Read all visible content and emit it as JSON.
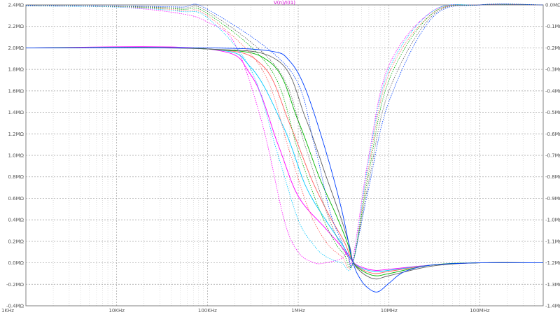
{
  "chart_data": {
    "type": "line",
    "title": "V(n)/I(I1)",
    "x_scale": "log",
    "xlim": [
      1000,
      500000000
    ],
    "x_ticks": [
      {
        "value": 1000,
        "label": "1KHz"
      },
      {
        "value": 10000,
        "label": "10KHz"
      },
      {
        "value": 100000,
        "label": "100KHz"
      },
      {
        "value": 1000000,
        "label": "1MHz"
      },
      {
        "value": 10000000,
        "label": "10MHz"
      },
      {
        "value": 100000000,
        "label": "100MHz"
      }
    ],
    "left_axis": {
      "unit": "MΩ",
      "ylim": [
        -0.4,
        2.4
      ],
      "ticks": [
        {
          "value": 2.4,
          "label": "2.4MΩ"
        },
        {
          "value": 2.2,
          "label": "2.2MΩ"
        },
        {
          "value": 2.0,
          "label": "2.0MΩ"
        },
        {
          "value": 1.8,
          "label": "1.8MΩ"
        },
        {
          "value": 1.6,
          "label": "1.6MΩ"
        },
        {
          "value": 1.4,
          "label": "1.4MΩ"
        },
        {
          "value": 1.2,
          "label": "1.2MΩ"
        },
        {
          "value": 1.0,
          "label": "1.0MΩ"
        },
        {
          "value": 0.8,
          "label": "0.8MΩ"
        },
        {
          "value": 0.6,
          "label": "0.6MΩ"
        },
        {
          "value": 0.4,
          "label": "0.4MΩ"
        },
        {
          "value": 0.2,
          "label": "0.2MΩ"
        },
        {
          "value": 0.0,
          "label": "0.0MΩ"
        },
        {
          "value": -0.2,
          "label": "-0.2MΩ"
        },
        {
          "value": -0.4,
          "label": "-0.4MΩ"
        }
      ]
    },
    "right_axis": {
      "unit": "MΩ",
      "ylim": [
        -1.4,
        0.0
      ],
      "ticks": [
        {
          "value": 0.0,
          "label": "0.0MΩ"
        },
        {
          "value": -0.1,
          "label": "-0.1MΩ"
        },
        {
          "value": -0.2,
          "label": "-0.2MΩ"
        },
        {
          "value": -0.3,
          "label": "-0.3MΩ"
        },
        {
          "value": -0.4,
          "label": "-0.4MΩ"
        },
        {
          "value": -0.5,
          "label": "-0.5MΩ"
        },
        {
          "value": -0.6,
          "label": "-0.6MΩ"
        },
        {
          "value": -0.7,
          "label": "-0.7MΩ"
        },
        {
          "value": -0.8,
          "label": "-0.8MΩ"
        },
        {
          "value": -0.9,
          "label": "-0.9MΩ"
        },
        {
          "value": -1.0,
          "label": "-1.0MΩ"
        },
        {
          "value": -1.1,
          "label": "-1.1MΩ"
        },
        {
          "value": -1.2,
          "label": "-1.2MΩ"
        },
        {
          "value": -1.3,
          "label": "-1.3MΩ"
        },
        {
          "value": -1.4,
          "label": "-1.4MΩ"
        }
      ]
    },
    "grid": true,
    "series": [
      {
        "axis": "left",
        "style": "solid",
        "color": "#ff00ff",
        "x": [
          1000,
          100000,
          300000,
          600000,
          1000000,
          2000000,
          3000000,
          4000000,
          5000000,
          7000000,
          10000000,
          30000000,
          100000000,
          500000000
        ],
        "y": [
          2.0,
          1.99,
          1.75,
          1.1,
          0.62,
          0.32,
          0.15,
          0.01,
          -0.04,
          -0.07,
          -0.06,
          -0.02,
          0.0,
          0.0
        ]
      },
      {
        "axis": "left",
        "style": "solid",
        "color": "#00c8ff",
        "x": [
          1000,
          100000,
          300000,
          700000,
          1200000,
          2000000,
          3000000,
          4000000,
          5000000,
          7000000,
          10000000,
          30000000,
          100000000,
          500000000
        ],
        "y": [
          2.0,
          1.99,
          1.82,
          1.25,
          0.72,
          0.4,
          0.18,
          0.01,
          -0.05,
          -0.08,
          -0.07,
          -0.02,
          0.0,
          0.0
        ]
      },
      {
        "axis": "left",
        "style": "solid",
        "color": "#ff6060",
        "x": [
          1000,
          100000,
          400000,
          800000,
          1400000,
          2200000,
          3200000,
          4000000,
          5000000,
          7000000,
          10000000,
          30000000,
          100000000,
          500000000
        ],
        "y": [
          2.0,
          1.99,
          1.84,
          1.3,
          0.78,
          0.44,
          0.2,
          0.01,
          -0.06,
          -0.1,
          -0.08,
          -0.02,
          0.0,
          0.0
        ]
      },
      {
        "axis": "left",
        "style": "solid",
        "color": "#00b400",
        "x": [
          1000,
          100000,
          500000,
          1000000,
          1700000,
          2600000,
          3500000,
          4000000,
          5000000,
          7000000,
          10000000,
          30000000,
          100000000,
          500000000
        ],
        "y": [
          2.0,
          1.99,
          1.86,
          1.32,
          0.8,
          0.45,
          0.18,
          0.01,
          -0.07,
          -0.12,
          -0.1,
          -0.02,
          0.0,
          0.0
        ]
      },
      {
        "axis": "left",
        "style": "solid",
        "color": "#606060",
        "x": [
          1000,
          100000,
          600000,
          1200000,
          2000000,
          3000000,
          3700000,
          4000000,
          5000000,
          7000000,
          10000000,
          30000000,
          100000000,
          500000000
        ],
        "y": [
          2.0,
          1.99,
          1.88,
          1.35,
          0.82,
          0.4,
          0.15,
          0.01,
          -0.09,
          -0.15,
          -0.12,
          -0.03,
          0.0,
          0.0
        ]
      },
      {
        "axis": "left",
        "style": "solid",
        "color": "#0040ff",
        "x": [
          1000,
          100000,
          500000,
          800000,
          1200000,
          2000000,
          3000000,
          4000000,
          5000000,
          6000000,
          7000000,
          8000000,
          10000000,
          15000000,
          30000000,
          100000000,
          500000000
        ],
        "y": [
          2.0,
          2.0,
          1.97,
          1.88,
          1.62,
          1.05,
          0.5,
          0.01,
          -0.17,
          -0.24,
          -0.27,
          -0.26,
          -0.19,
          -0.08,
          -0.02,
          0.0,
          0.0
        ]
      },
      {
        "axis": "right",
        "style": "dotted",
        "color": "#ff00ff",
        "x": [
          1000,
          10000,
          50000,
          100000,
          200000,
          400000,
          700000,
          1000000,
          1500000,
          2000000,
          3000000,
          3500000,
          4000000,
          6000000,
          10000000,
          30000000,
          100000000,
          500000000
        ],
        "y": [
          -0.005,
          -0.01,
          -0.04,
          -0.08,
          -0.18,
          -0.55,
          -1.0,
          -1.15,
          -1.2,
          -1.2,
          -1.18,
          -1.15,
          -1.18,
          -0.7,
          -0.28,
          -0.03,
          0.0,
          0.0
        ]
      },
      {
        "axis": "right",
        "style": "dotted",
        "color": "#00c8ff",
        "x": [
          1000,
          10000,
          50000,
          100000,
          300000,
          600000,
          1000000,
          1500000,
          2000000,
          3000000,
          4000000,
          6000000,
          10000000,
          30000000,
          100000000,
          500000000
        ],
        "y": [
          -0.005,
          -0.01,
          -0.03,
          -0.06,
          -0.3,
          -0.7,
          -1.0,
          -1.12,
          -1.17,
          -1.2,
          -1.2,
          -0.72,
          -0.3,
          -0.03,
          0.0,
          0.0
        ]
      },
      {
        "axis": "right",
        "style": "dotted",
        "color": "#ff6060",
        "x": [
          1000,
          10000,
          50000,
          100000,
          400000,
          800000,
          1300000,
          2000000,
          3000000,
          4000000,
          6000000,
          10000000,
          30000000,
          100000000,
          500000000
        ],
        "y": [
          -0.004,
          -0.008,
          -0.025,
          -0.05,
          -0.3,
          -0.68,
          -0.95,
          -1.1,
          -1.17,
          -1.2,
          -0.75,
          -0.32,
          -0.04,
          0.0,
          0.0
        ]
      },
      {
        "axis": "right",
        "style": "dotted",
        "color": "#00b400",
        "x": [
          1000,
          10000,
          50000,
          100000,
          500000,
          1000000,
          1700000,
          2500000,
          3200000,
          4000000,
          6000000,
          10000000,
          30000000,
          100000000,
          500000000
        ],
        "y": [
          -0.004,
          -0.007,
          -0.02,
          -0.04,
          -0.3,
          -0.68,
          -0.95,
          -1.1,
          -1.16,
          -1.2,
          -0.78,
          -0.35,
          -0.04,
          0.0,
          0.0
        ]
      },
      {
        "axis": "right",
        "style": "dotted",
        "color": "#606060",
        "x": [
          1000,
          10000,
          50000,
          100000,
          600000,
          1200000,
          2000000,
          2800000,
          3500000,
          4000000,
          6000000,
          10000000,
          30000000,
          100000000,
          500000000
        ],
        "y": [
          -0.003,
          -0.006,
          -0.015,
          -0.03,
          -0.3,
          -0.66,
          -0.95,
          -1.1,
          -1.17,
          -1.2,
          -0.82,
          -0.4,
          -0.05,
          0.0,
          0.0
        ]
      },
      {
        "axis": "right",
        "style": "dotted",
        "color": "#0040ff",
        "x": [
          1000,
          10000,
          50000,
          100000,
          800000,
          1500000,
          2200000,
          3000000,
          3600000,
          4000000,
          6000000,
          10000000,
          30000000,
          100000000,
          500000000
        ],
        "y": [
          -0.003,
          -0.005,
          -0.01,
          -0.02,
          -0.3,
          -0.65,
          -0.95,
          -1.1,
          -1.17,
          -1.2,
          -0.85,
          -0.45,
          -0.06,
          0.0,
          0.0
        ]
      }
    ]
  }
}
